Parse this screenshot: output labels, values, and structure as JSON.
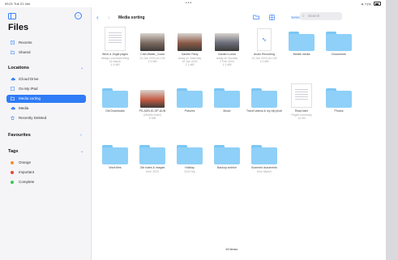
{
  "status": {
    "time": "09:21 Tue 21 Jan",
    "battery": "71%"
  },
  "sidebar": {
    "title": "Files",
    "top_items": [
      {
        "label": "Recents",
        "icon": "clock-icon"
      },
      {
        "label": "Shared",
        "icon": "shared-folder-icon"
      }
    ],
    "locations_header": "Locations",
    "locations": [
      {
        "label": "iCloud Drive",
        "icon": "cloud-icon"
      },
      {
        "label": "On My iPad",
        "icon": "ipad-icon"
      },
      {
        "label": "Media sorting",
        "icon": "folder-icon"
      },
      {
        "label": "Media",
        "icon": "cloud-icon"
      },
      {
        "label": "Recently Deleted",
        "icon": "trash-icon"
      }
    ],
    "selected_index": 2,
    "favourites_header": "Favourites",
    "tags_header": "Tags",
    "tags": [
      {
        "label": "Orange",
        "color": "#f0902c"
      },
      {
        "label": "Important",
        "color": "#e6463c"
      },
      {
        "label": "Complete",
        "color": "#3cc65a"
      }
    ]
  },
  "toolbar": {
    "title": "Media sorting",
    "select_label": "Select",
    "search_placeholder": "Search"
  },
  "items": [
    {
      "name": "Wind & Jingle pages",
      "meta": [
        "design-concepts-thing",
        "16 March",
        "1.4 MB"
      ],
      "kind": "doc"
    },
    {
      "name": "Chef-Waiter_Coast",
      "meta": [
        "10 Jan 2024 at 1:09",
        "1.3 MB"
      ],
      "kind": "photo",
      "color": "#7b6a60"
    },
    {
      "name": "Garden Party",
      "meta": [
        "Away on Saturday",
        "10 Jan 2024",
        "1.1 MB"
      ],
      "kind": "photo",
      "color": "#8c5a47"
    },
    {
      "name": "Garden Lunch",
      "meta": [
        "Away on Sunday",
        "2 Feb 2024",
        "1.1 MB"
      ],
      "kind": "photo",
      "color": "#6a6d78"
    },
    {
      "name": "Audio Recording",
      "meta": [
        "10 Jan 2024 at 1:09",
        "1.3 MB"
      ],
      "kind": "audio"
    },
    {
      "name": "Mobile media",
      "meta": [],
      "kind": "folder"
    },
    {
      "name": "Documents",
      "meta": [],
      "kind": "folder"
    },
    {
      "name": "Old Downloads",
      "meta": [],
      "kind": "folder"
    },
    {
      "name": "PS-ADN-ID-GP-AUN",
      "meta": [
        "(Mobile-hotel)",
        "5 MB"
      ],
      "kind": "photo",
      "color": "#c45a43"
    },
    {
      "name": "Pictures",
      "meta": [],
      "kind": "folder"
    },
    {
      "name": "Music",
      "meta": [],
      "kind": "folder"
    },
    {
      "name": "Travel videos & my trip photos",
      "meta": [],
      "kind": "folder"
    },
    {
      "name": "Read later",
      "meta": [
        "Pages summary",
        "14 KB"
      ],
      "kind": "doc"
    },
    {
      "name": "Photos",
      "meta": [],
      "kind": "folder"
    },
    {
      "name": "Work files",
      "meta": [],
      "kind": "folder"
    },
    {
      "name": "Old notes & images",
      "meta": [
        "from 2023"
      ],
      "kind": "folder"
    },
    {
      "name": "Holiday",
      "meta": [
        "2024 trip"
      ],
      "kind": "folder"
    },
    {
      "name": "Backup archive",
      "meta": [],
      "kind": "folder"
    },
    {
      "name": "Scanned documents",
      "meta": [
        "from March"
      ],
      "kind": "folder"
    }
  ],
  "footer": {
    "count": "19 items"
  }
}
